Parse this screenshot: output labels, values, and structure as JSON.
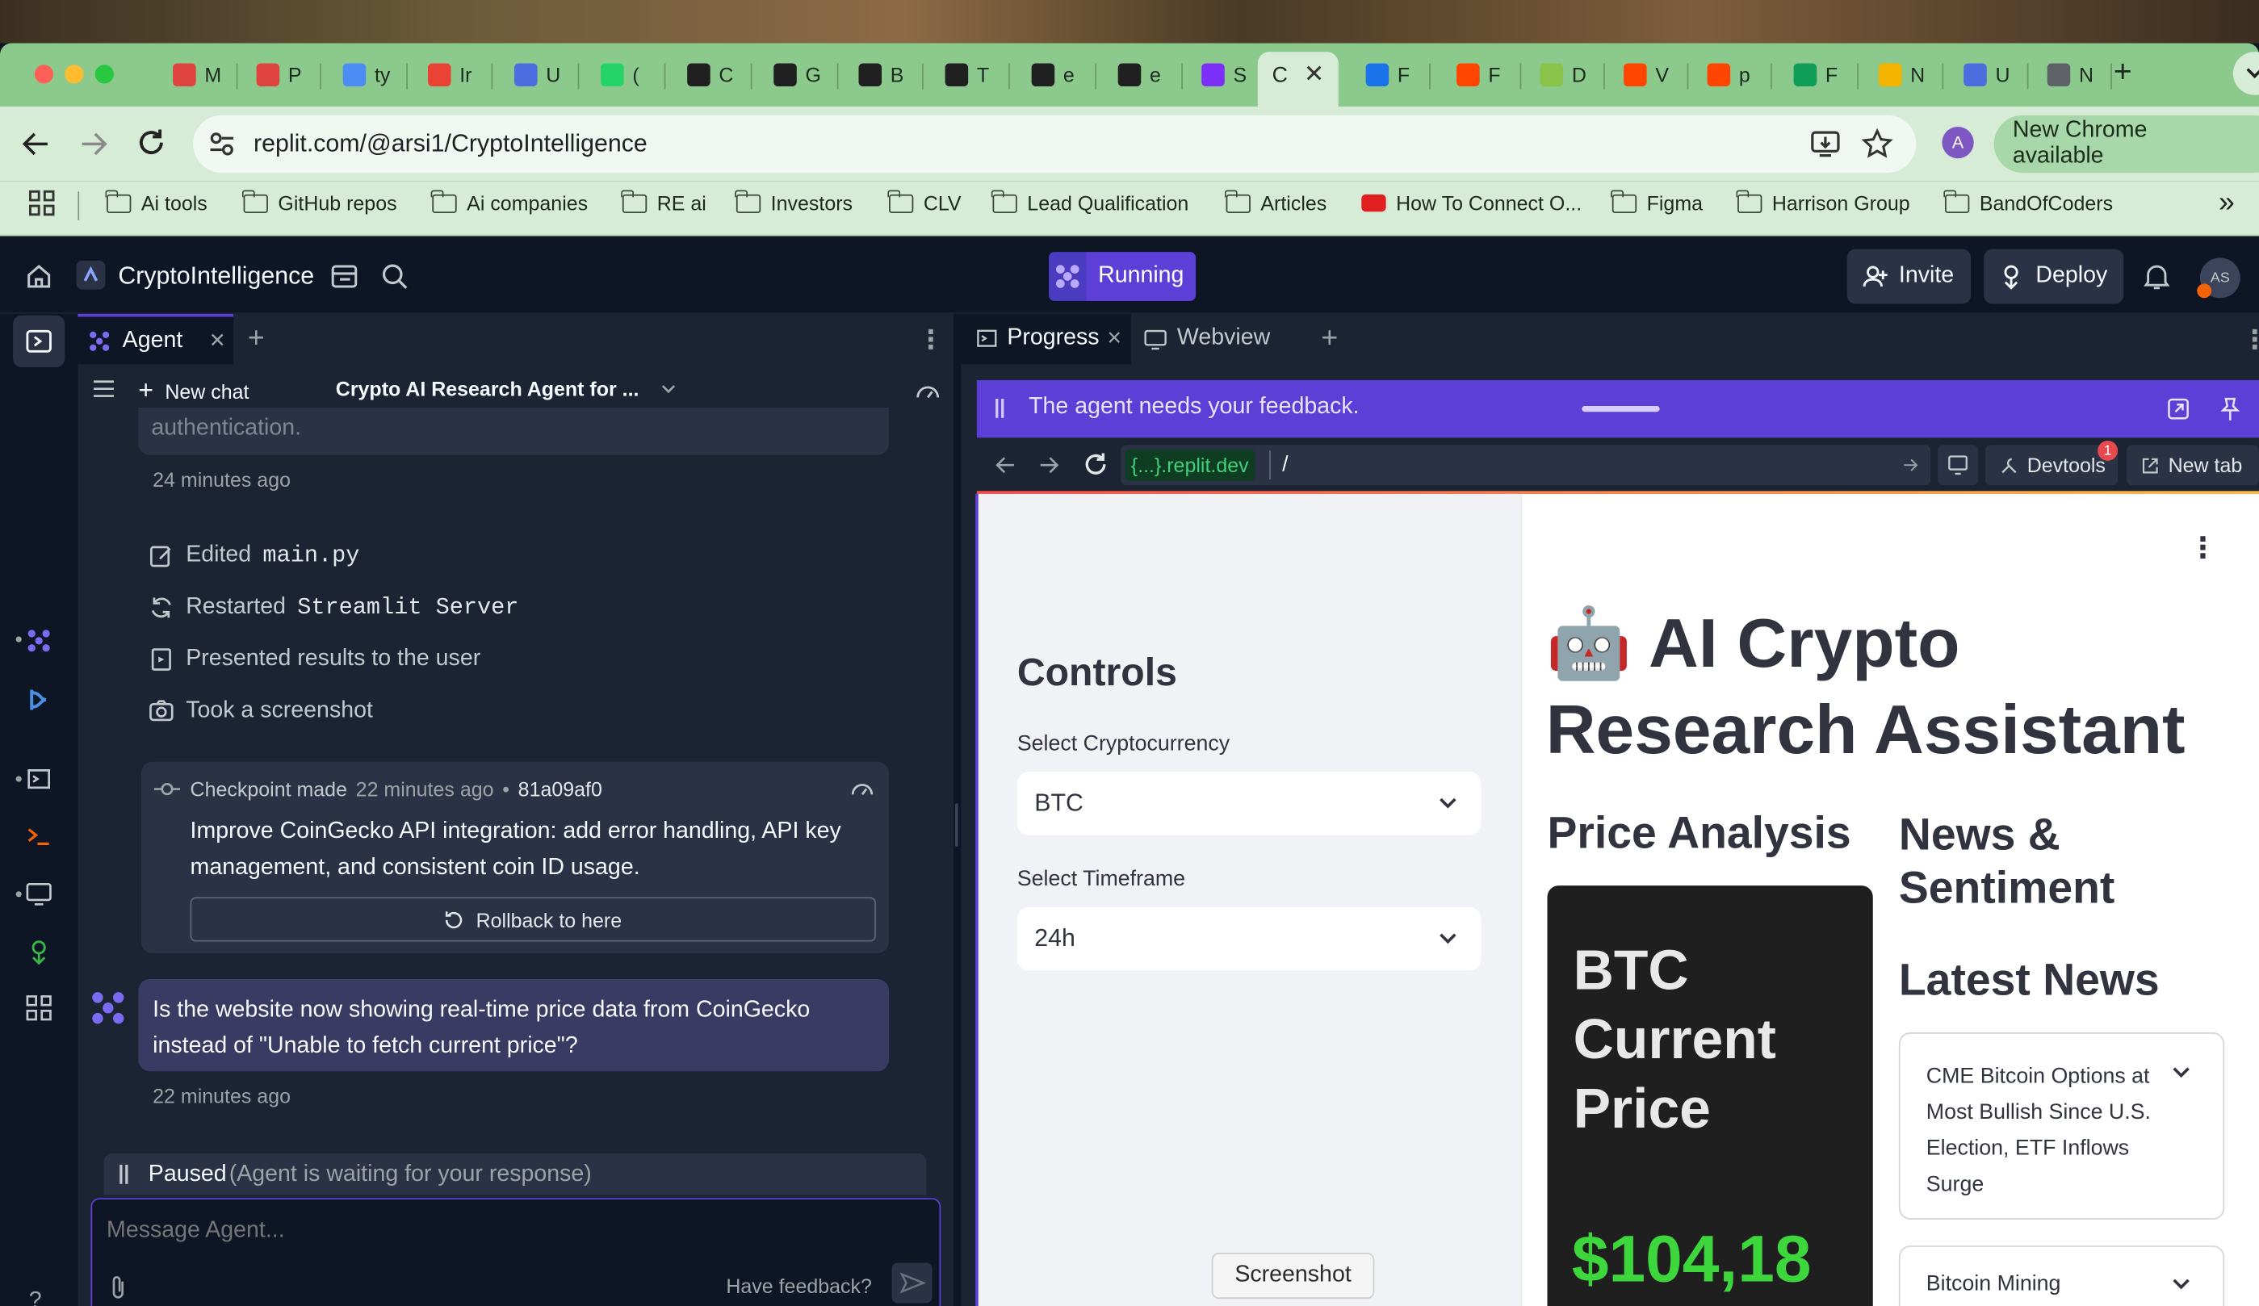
{
  "browser": {
    "tabs": [
      {
        "label": "M",
        "color": "#e0443e"
      },
      {
        "label": "P",
        "color": "#e0443e"
      },
      {
        "label": "ty",
        "color": "#4b8cf5"
      },
      {
        "label": "Ir",
        "color": "#ea4335"
      },
      {
        "label": "U",
        "color": "#4a6ee0"
      },
      {
        "label": "(",
        "color": "#25d366"
      },
      {
        "label": "C",
        "color": "#202020"
      },
      {
        "label": "G",
        "color": "#202020"
      },
      {
        "label": "B",
        "color": "#202020"
      },
      {
        "label": "T",
        "color": "#202020"
      },
      {
        "label": "e",
        "color": "#202020"
      },
      {
        "label": "e",
        "color": "#202020"
      },
      {
        "label": "S",
        "color": "#7b2ff7"
      },
      {
        "label": "C",
        "color": "#1a73e8"
      },
      {
        "label": "F",
        "color": "#1a73e8"
      },
      {
        "label": "F",
        "color": "#ff4500"
      },
      {
        "label": "D",
        "color": "#8bc34a"
      },
      {
        "label": "V",
        "color": "#ff4500"
      },
      {
        "label": "p",
        "color": "#ff4500"
      },
      {
        "label": "F",
        "color": "#0f9d58"
      },
      {
        "label": "N",
        "color": "#f4b400"
      },
      {
        "label": "U",
        "color": "#4a6ee0"
      },
      {
        "label": "N",
        "color": "#5f6368"
      }
    ],
    "active_tab_label": "C",
    "url": "replit.com/@arsi1/CryptoIntelligence",
    "update_label": "New Chrome available",
    "profile_initial": "A",
    "bookmarks": [
      "Ai tools",
      "GitHub repos",
      "Ai companies",
      "RE ai",
      "Investors",
      "CLV",
      "Lead Qualification",
      "Articles",
      "How To Connect O...",
      "Figma",
      "Harrison Group",
      "BandOfCoders"
    ]
  },
  "replit": {
    "repl_name": "CryptoIntelligence",
    "status": "Running",
    "invite": "Invite",
    "deploy": "Deploy",
    "avatar": "AS",
    "left_tab": "Agent",
    "new_chat": "New chat",
    "chat_title": "Crypto AI Research Agent for ...",
    "prev_msg_tail": "authentication.",
    "time1": "24 minutes ago",
    "actions": [
      {
        "text": "Edited",
        "code": "main.py",
        "icon": "edit-icon"
      },
      {
        "text": "Restarted",
        "code": "Streamlit Server",
        "icon": "restart-icon"
      },
      {
        "text": "Presented results to the user",
        "code": "",
        "icon": "present-icon"
      },
      {
        "text": "Took a screenshot",
        "code": "",
        "icon": "camera-icon"
      }
    ],
    "checkpoint": {
      "label": "Checkpoint made",
      "time": "22 minutes ago",
      "sep": "•",
      "hash": "81a09af0",
      "body": "Improve CoinGecko API integration: add error handling, API key management, and consistent coin ID usage.",
      "rollback": "Rollback to here"
    },
    "agent_msg": "Is the website now showing real-time price data from CoinGecko instead of \"Unable to fetch current price\"?",
    "time2": "22 minutes ago",
    "paused": "Paused",
    "paused_detail": "(Agent is waiting for your response)",
    "message_placeholder": "Message Agent...",
    "feedback_link": "Have feedback?",
    "right_tabs": [
      "Progress",
      "Webview"
    ],
    "feedback_banner": "The agent needs your feedback.",
    "webview_domain": "{...}.replit.dev",
    "webview_path": "/",
    "devtools": "Devtools",
    "devtools_badge": "1",
    "new_tab": "New tab",
    "tooltip": "Screenshot"
  },
  "app": {
    "controls_title": "Controls",
    "crypto_label": "Select Cryptocurrency",
    "crypto_value": "BTC",
    "timeframe_label": "Select Timeframe",
    "timeframe_value": "24h",
    "title_emoji": "🤖",
    "title": "AI Crypto Research Assistant",
    "price_heading": "Price Analysis",
    "news_heading": "News & Sentiment",
    "price_card_title": "BTC Current Price",
    "price_value": "$104,18",
    "latest_news": "Latest News",
    "news": [
      "CME Bitcoin Options at Most Bullish Since U.S. Election, ETF Inflows Surge",
      "Bitcoin Mining"
    ]
  }
}
